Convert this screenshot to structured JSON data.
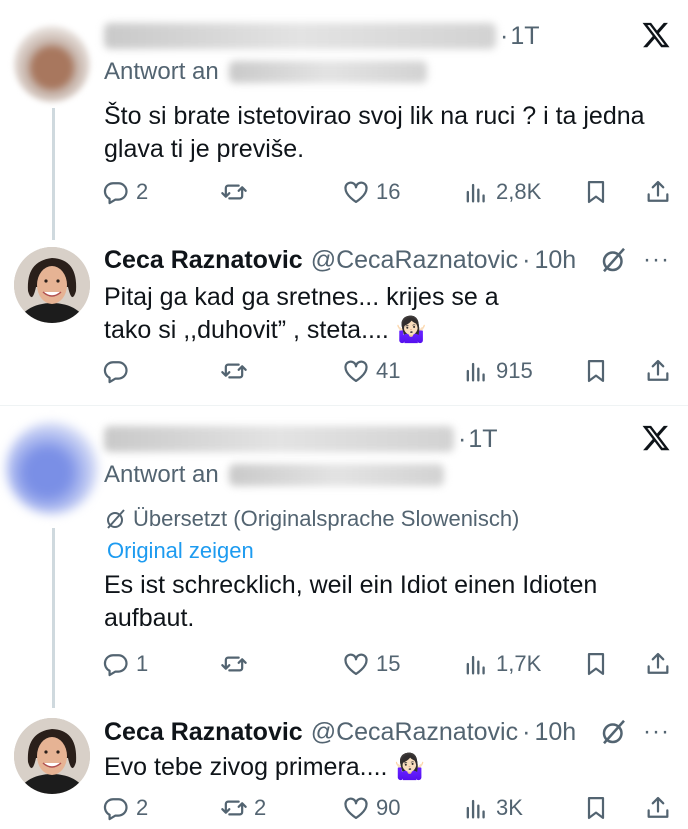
{
  "tweets": [
    {
      "time": "1T",
      "reply_prefix": "Antwort an",
      "text": "Što si brate istetovirao svoj lik na ruci ?  i ta jedna glava ti je previše.",
      "stats": {
        "replies": "2",
        "reposts": "",
        "likes": "16",
        "views": "2,8K"
      }
    },
    {
      "name": "Ceca Raznatovic",
      "handle": "@CecaRaznatovic",
      "time": "10h",
      "text": "Pitaj ga kad ga sretnes... krijes se a tako si ,,duhovit” , steta.... 🤷🏻‍♀️",
      "stats": {
        "replies": "",
        "reposts": "",
        "likes": "41",
        "views": "915"
      }
    },
    {
      "time": "1T",
      "reply_prefix": "Antwort an",
      "translated_note": "Übersetzt (Originalsprache Slowenisch)",
      "original_link": "Original zeigen",
      "text": "Es ist schrecklich, weil ein Idiot einen Idioten aufbaut.",
      "stats": {
        "replies": "1",
        "reposts": "",
        "likes": "15",
        "views": "1,7K"
      }
    },
    {
      "name": "Ceca Raznatovic",
      "handle": "@CecaRaznatovic",
      "time": "10h",
      "text": "Evo tebe zivog primera.... 🤷🏻‍♀️",
      "stats": {
        "replies": "2",
        "reposts": "2",
        "likes": "90",
        "views": "3K"
      }
    }
  ],
  "separator": "·",
  "more_label": "···"
}
